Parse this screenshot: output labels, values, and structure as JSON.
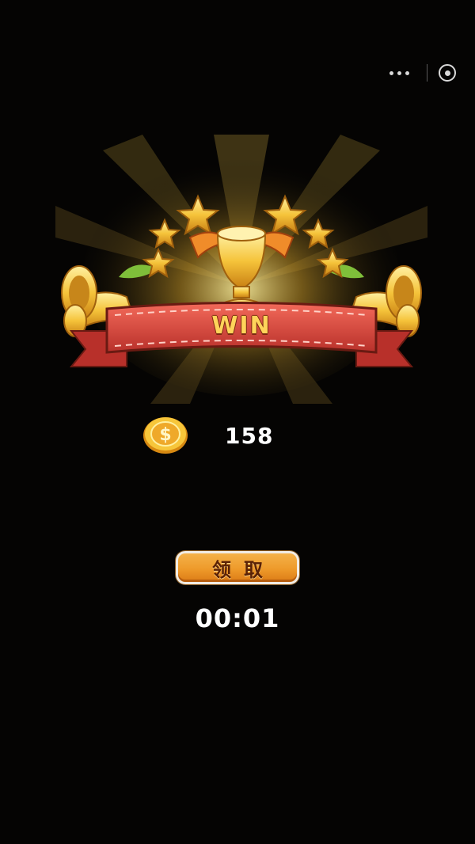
{
  "capsule": {
    "more_icon": "more-dots-icon",
    "close_icon": "close-circle-icon"
  },
  "result": {
    "title": "WIN",
    "trophy_icon": "winged-trophy-icon"
  },
  "reward": {
    "coin_icon": "dollar-coin-icon",
    "amount": "158"
  },
  "claim_button": {
    "label": "领取"
  },
  "timer": {
    "value": "00:01"
  },
  "colors": {
    "background": "#050403",
    "banner_red": "#d9443a",
    "gold": "#f5c33a",
    "button_orange": "#ee9a2a",
    "win_text": "#ffd45a"
  }
}
